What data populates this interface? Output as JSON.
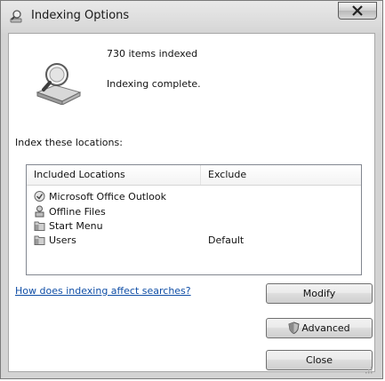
{
  "window": {
    "title": "Indexing Options",
    "title_icon": "indexing-magnifier-icon",
    "close_icon": "close-x-icon"
  },
  "status": {
    "items_count": "730 items indexed",
    "message": "Indexing complete.",
    "icon": "drive-magnifier-icon"
  },
  "locations": {
    "heading": "Index these locations:",
    "columns": {
      "included": "Included Locations",
      "exclude": "Exclude"
    },
    "rows": [
      {
        "label": "Microsoft Office Outlook",
        "exclude": "",
        "icon": "outlook-icon"
      },
      {
        "label": "Offline Files",
        "exclude": "",
        "icon": "offline-files-icon"
      },
      {
        "label": "Start Menu",
        "exclude": "",
        "icon": "folder-icon"
      },
      {
        "label": "Users",
        "exclude": "Default",
        "icon": "folder-icon"
      }
    ]
  },
  "help_link": "How does indexing affect searches?",
  "buttons": {
    "modify": "Modify",
    "advanced": "Advanced",
    "close": "Close"
  },
  "colors": {
    "link": "#0f4ea6",
    "window_frame": "#d9d9d9"
  }
}
